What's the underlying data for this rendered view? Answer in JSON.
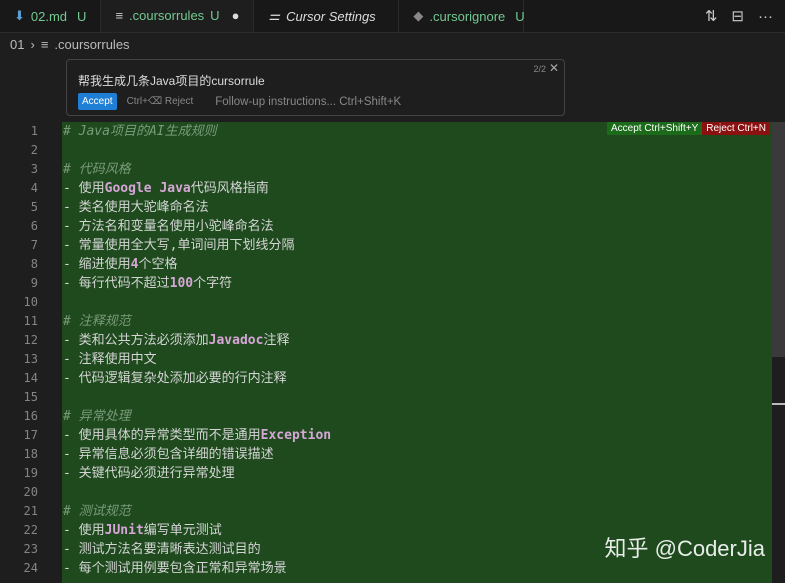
{
  "tabs": [
    {
      "label": "02.md",
      "status": "U",
      "icon": "markdown-icon"
    },
    {
      "label": ".coursorrules",
      "status": "U",
      "icon": "file-icon",
      "active": true,
      "dirty": true
    },
    {
      "label": "Cursor Settings",
      "icon": "settings-icon"
    },
    {
      "label": ".cursorignore",
      "status": "U",
      "icon": "ignore-icon"
    }
  ],
  "breadcrumb": {
    "folder": "01",
    "file": ".coursorrules"
  },
  "inline_chat": {
    "prompt": "帮我生成几条Java项目的cursorrule",
    "counter": "2/2",
    "accept": "Accept",
    "reject": "Ctrl+⌫ Reject",
    "followup": "Follow-up instructions... Ctrl+Shift+K"
  },
  "diff": {
    "accept": "Accept Ctrl+Shift+Y",
    "reject": "Reject Ctrl+N",
    "accept_color": "#1b6b1b",
    "reject_color": "#8b1111"
  },
  "lines": [
    [
      [
        "cm",
        "# Java项目的AI生成规则"
      ]
    ],
    [],
    [
      [
        "cm",
        "# 代码风格"
      ]
    ],
    [
      [
        "t",
        "- 使用"
      ],
      [
        "kw",
        "Google Java"
      ],
      [
        "t",
        "代码风格指南"
      ]
    ],
    [
      [
        "t",
        "- 类名使用大驼峰命名法"
      ]
    ],
    [
      [
        "t",
        "- 方法名和变量名使用小驼峰命名法"
      ]
    ],
    [
      [
        "t",
        "- 常量使用全大写,单词间用下划线分隔"
      ]
    ],
    [
      [
        "t",
        "- 缩进使用"
      ],
      [
        "kw",
        "4"
      ],
      [
        "t",
        "个空格"
      ]
    ],
    [
      [
        "t",
        "- 每行代码不超过"
      ],
      [
        "kw",
        "100"
      ],
      [
        "t",
        "个字符"
      ]
    ],
    [],
    [
      [
        "cm",
        "# 注释规范"
      ]
    ],
    [
      [
        "t",
        "- 类和公共方法必须添加"
      ],
      [
        "kw",
        "Javadoc"
      ],
      [
        "t",
        "注释"
      ]
    ],
    [
      [
        "t",
        "- 注释使用中文"
      ]
    ],
    [
      [
        "t",
        "- 代码逻辑复杂处添加必要的行内注释"
      ]
    ],
    [],
    [
      [
        "cm",
        "# 异常处理"
      ]
    ],
    [
      [
        "t",
        "- 使用具体的异常类型而不是通用"
      ],
      [
        "kw",
        "Exception"
      ]
    ],
    [
      [
        "t",
        "- 异常信息必须包含详细的错误描述"
      ]
    ],
    [
      [
        "t",
        "- 关键代码必须进行异常处理"
      ]
    ],
    [],
    [
      [
        "cm",
        "# 测试规范"
      ]
    ],
    [
      [
        "t",
        "- 使用"
      ],
      [
        "kw",
        "JUnit"
      ],
      [
        "t",
        "编写单元测试"
      ]
    ],
    [
      [
        "t",
        "- 测试方法名要清晰表达测试目的"
      ]
    ],
    [
      [
        "t",
        "- 每个测试用例要包含正常和异常场景"
      ]
    ]
  ],
  "watermark": "知乎 @CoderJia"
}
